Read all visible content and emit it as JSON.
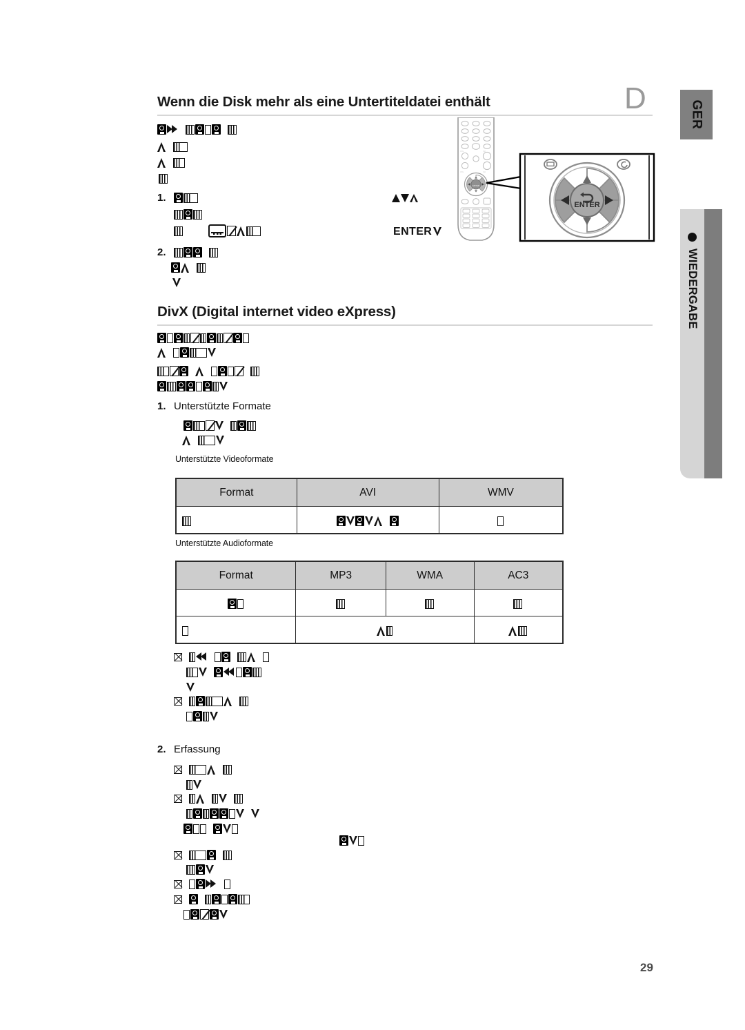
{
  "page": {
    "number": "29",
    "language_tab": "GER",
    "section_tab": "WIEDERGABE",
    "disc_marker": "D"
  },
  "headings": {
    "subtitle_section": "Wenn die Disk mehr als eine Untertiteldatei enthält",
    "divx_section": "DivX (Digital internet video eXpress)"
  },
  "steps": {
    "step1_number": "1.",
    "step2_number": "2.",
    "formats_number": "1.",
    "formats_label": "Unterstützte Formate",
    "capture_number": "2.",
    "capture_label": "Erfassung"
  },
  "keys": {
    "enter_label": "ENTER",
    "cursor_label": "ENTER",
    "remote_enter": "ENTER"
  },
  "video_table": {
    "caption": "Unterstützte Videoformate",
    "headers": [
      "Format",
      "AVI",
      "WMV"
    ],
    "rows": [
      [
        "",
        "",
        ""
      ]
    ]
  },
  "audio_table": {
    "caption": "Unterstützte Audioformate",
    "headers": [
      "Format",
      "MP3",
      "WMA",
      "AC3"
    ],
    "rows": [
      [
        "",
        "",
        "",
        ""
      ],
      [
        "",
        "",
        ""
      ]
    ]
  },
  "colors": {
    "tab_language": "#808080",
    "tab_section": "#d5d5d5",
    "tab_strip": "#7d7d7d",
    "table_header": "#cdcdcd",
    "rule": "#d6d6d6",
    "disc_marker": "#9a9a9a"
  }
}
